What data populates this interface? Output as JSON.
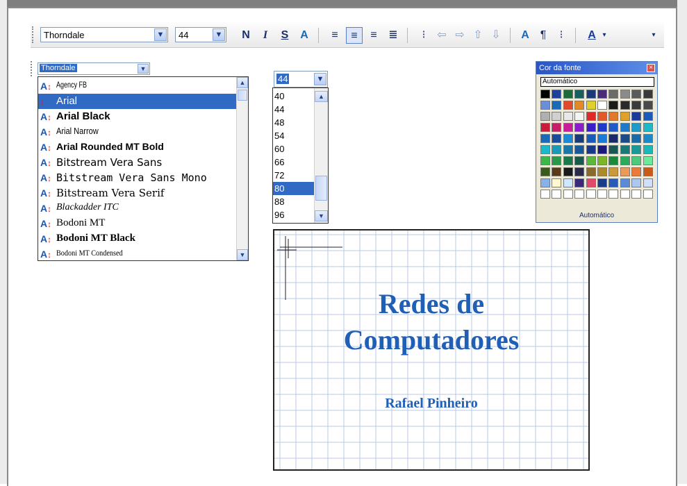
{
  "toolbar": {
    "font_name": "Thorndale",
    "font_size": "44",
    "bold_label": "N",
    "italic_label": "I",
    "shadow_label": "S",
    "color_label": "A"
  },
  "font_dropdown": {
    "value": "Thorndale",
    "items": [
      {
        "name": "Agency FB",
        "selected": false
      },
      {
        "name": "Arial",
        "selected": true
      },
      {
        "name": "Arial Black",
        "selected": false
      },
      {
        "name": "Arial Narrow",
        "selected": false
      },
      {
        "name": "Arial Rounded MT Bold",
        "selected": false
      },
      {
        "name": "Bitstream Vera Sans",
        "selected": false
      },
      {
        "name": "Bitstream Vera Sans Mono",
        "selected": false
      },
      {
        "name": "Bitstream Vera Serif",
        "selected": false
      },
      {
        "name": "Blackadder ITC",
        "selected": false
      },
      {
        "name": "Bodoni MT",
        "selected": false
      },
      {
        "name": "Bodoni MT Black",
        "selected": false
      },
      {
        "name": "Bodoni MT Condensed",
        "selected": false
      }
    ]
  },
  "size_dropdown": {
    "value": "44",
    "items": [
      "40",
      "44",
      "48",
      "54",
      "60",
      "66",
      "72",
      "80",
      "88",
      "96"
    ],
    "selected": "80"
  },
  "color_panel": {
    "title": "Cor da fonte",
    "auto_top": "Automático",
    "auto_bottom": "Automático",
    "swatches": [
      [
        "#000000",
        "#1f3f9a",
        "#1d6b3a",
        "#1a5f5f",
        "#1a3a7a",
        "#4a2a7a",
        "#6a6a6a",
        "#8a8a8a",
        "#5a5a5a",
        "#3a3a3a"
      ],
      [
        "#6a8ed8",
        "#1a6ab8",
        "#e04a2a",
        "#e08a2a",
        "#e0d02a",
        "#ffffff",
        "#1a1a1a",
        "#2a2a2a",
        "#3a3a3a",
        "#4a4a4a"
      ],
      [
        "#b0b0b0",
        "#d0d0d0",
        "#e8e8e8",
        "#f4f4f4",
        "#e02a2a",
        "#e05a2a",
        "#e07a2a",
        "#e0a02a",
        "#1a3a9a",
        "#1a5ab8"
      ],
      [
        "#c81e3c",
        "#c81e6a",
        "#c81e9a",
        "#8a1ec8",
        "#3a1ec8",
        "#1e3ac8",
        "#1e5ac8",
        "#1e7ac8",
        "#1e9ac8",
        "#1eb8c8"
      ],
      [
        "#1a6ab8",
        "#1a4a98",
        "#1a8ad8",
        "#1a3a78",
        "#1a5ab8",
        "#1a7ad8",
        "#1a2a68",
        "#1a4a88",
        "#1a6aa8",
        "#1a8ac8"
      ],
      [
        "#1ab8c8",
        "#1a98b8",
        "#1a78a8",
        "#1a5898",
        "#1a3888",
        "#1a1878",
        "#1a5858",
        "#1a7878",
        "#1a9898",
        "#1ab8b8"
      ],
      [
        "#3ab84a",
        "#2a984a",
        "#1a784a",
        "#1a584a",
        "#5ab83a",
        "#7ab82a",
        "#1a8a3a",
        "#2aaa5a",
        "#4aca7a",
        "#6aea9a"
      ],
      [
        "#3a5a1a",
        "#5a3a1a",
        "#1a1a1a",
        "#2a2a4a",
        "#8a6a2a",
        "#aa8a2a",
        "#ca9a3a",
        "#ea9a5a",
        "#ea7a3a",
        "#ca5a1a"
      ],
      [
        "#8ab0e8",
        "#fff8d0",
        "#d0e8ff",
        "#3a2a7a",
        "#e04a6a",
        "#1a3a8a",
        "#2a5ab8",
        "#5a8ad8",
        "#aac8f0",
        "#d0e0f8"
      ],
      [
        "#ffffff",
        "#ffffff",
        "#ffffff",
        "#ffffff",
        "#ffffff",
        "#ffffff",
        "#ffffff",
        "#ffffff",
        "#ffffff",
        "#ffffff"
      ]
    ]
  },
  "slide": {
    "title_line1": "Redes de",
    "title_line2": "Computadores",
    "author": "Rafael Pinheiro"
  }
}
